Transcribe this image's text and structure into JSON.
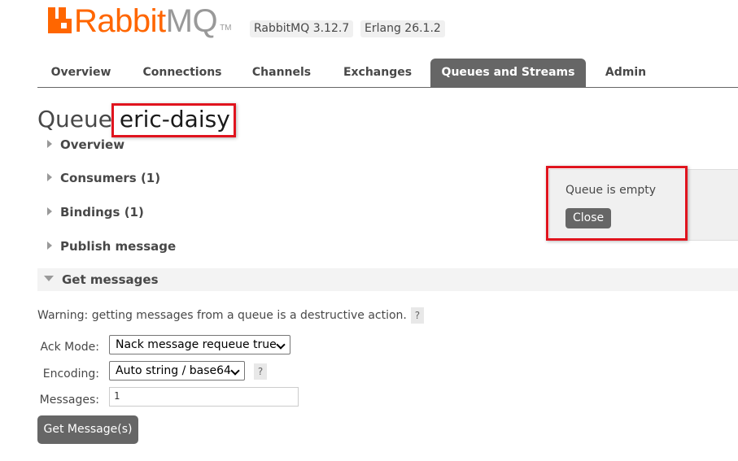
{
  "brand": {
    "logo_primary": "Rabbit",
    "logo_secondary": "MQ",
    "logo_tm": "TM",
    "primary_color": "#ff6600",
    "secondary_color": "#999999"
  },
  "versions": {
    "rabbitmq": "RabbitMQ 3.12.7",
    "erlang": "Erlang 26.1.2"
  },
  "tabs": [
    {
      "label": "Overview",
      "active": false
    },
    {
      "label": "Connections",
      "active": false
    },
    {
      "label": "Channels",
      "active": false
    },
    {
      "label": "Exchanges",
      "active": false
    },
    {
      "label": "Queues and Streams",
      "active": true
    },
    {
      "label": "Admin",
      "active": false
    }
  ],
  "page": {
    "title_prefix": "Queue",
    "queue_name": "eric-daisy"
  },
  "sections": {
    "overview": "Overview",
    "consumers": "Consumers (1)",
    "bindings": "Bindings (1)",
    "publish": "Publish message",
    "get": "Get messages"
  },
  "popup": {
    "message": "Queue is empty",
    "close_label": "Close"
  },
  "get_messages": {
    "warning": "Warning: getting messages from a queue is a destructive action.",
    "help_glyph": "?",
    "ack_mode_label": "Ack Mode:",
    "ack_mode_value": "Nack message requeue true",
    "encoding_label": "Encoding:",
    "encoding_value": "Auto string / base64",
    "messages_label": "Messages:",
    "messages_value": "1",
    "submit_label": "Get Message(s)"
  },
  "highlight_color": "#e0141e"
}
